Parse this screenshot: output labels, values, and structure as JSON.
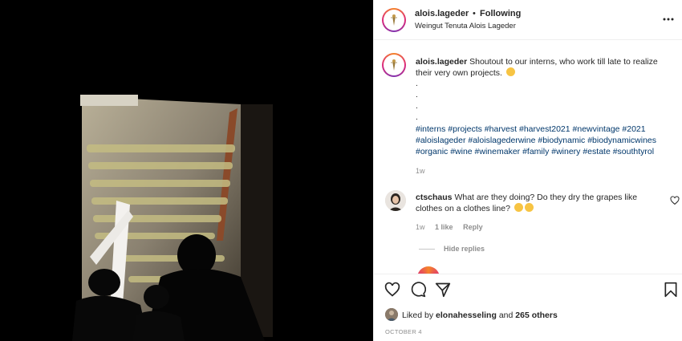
{
  "post": {
    "username": "alois.lageder",
    "separator": "•",
    "follow_status": "Following",
    "location": "Weingut Tenuta Alois Lageder"
  },
  "caption": {
    "username": "alois.lageder",
    "text": "Shoutout to our interns, who work till late to realize their very own projects.",
    "dots": [
      ".",
      ".",
      ".",
      "."
    ],
    "hashtags": "#interns #projects #harvest #harvest2021 #newvintage #2021 #aloislageder #aloislagederwine #biodynamic #biodynamicwines #organic #wine #winemaker #family #winery #estate #southtyrol",
    "time": "1w"
  },
  "comment": {
    "username": "ctschaus",
    "text": "What are they doing? Do they dry the grapes like clothes on a clothes line?",
    "time": "1w",
    "likes": "1 like",
    "reply": "Reply",
    "hide_replies": "Hide replies"
  },
  "likes": {
    "prefix": "Liked by",
    "user": "elonahesseling",
    "joiner": "and",
    "others": "265 others"
  },
  "date": "OCTOBER 4",
  "icons": [
    "more-options-icon",
    "heart-icon",
    "comment-icon",
    "share-icon",
    "bookmark-icon",
    "small-heart-icon"
  ],
  "colors": {
    "hashtag": "#00376b",
    "secondary_text": "#8e8e8e",
    "border": "#efefef",
    "photo_bg": "#000000"
  }
}
